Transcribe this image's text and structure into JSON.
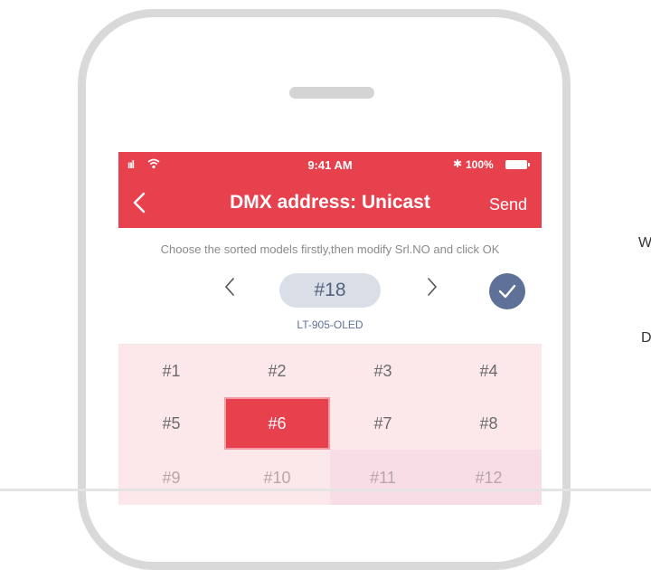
{
  "status_bar": {
    "signal": "ııl",
    "time": "9:41 AM",
    "bluetooth": "✱",
    "battery_percent": "100%"
  },
  "nav": {
    "title": "DMX address: Unicast",
    "send_label": "Send"
  },
  "panel": {
    "hint": "Choose the sorted models firstly,then modify Srl.NO and click OK",
    "serial": "#18",
    "model": "LT-905-OLED"
  },
  "grid": {
    "cells": [
      "#1",
      "#2",
      "#3",
      "#4",
      "#5",
      "#6",
      "#7",
      "#8",
      "#9",
      "#10",
      "#11",
      "#12"
    ],
    "selected": "#6"
  },
  "side_text": {
    "line1": "W",
    "line2": "D"
  },
  "colors": {
    "accent": "#e8414e",
    "confirm": "#5f7198",
    "grid_bg": "#fce8ea"
  },
  "icons": {
    "back": "back-chevron-icon",
    "prev": "chevron-left-icon",
    "next": "chevron-right-icon",
    "confirm": "checkmark-icon",
    "wifi": "wifi-icon",
    "battery": "battery-icon"
  }
}
